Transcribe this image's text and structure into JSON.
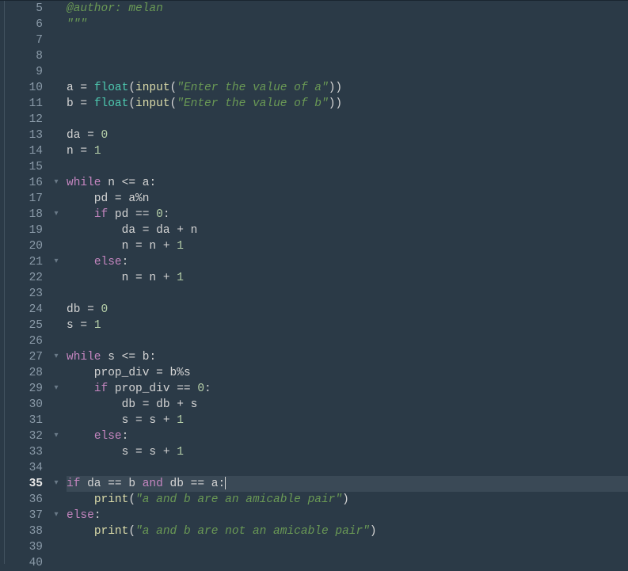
{
  "lines": [
    {
      "num": 5,
      "fold": "",
      "highlight": false,
      "tokens": [
        [
          "cm",
          "@author: melan"
        ]
      ]
    },
    {
      "num": 6,
      "fold": "",
      "highlight": false,
      "tokens": [
        [
          "str",
          "\"\"\""
        ]
      ]
    },
    {
      "num": 7,
      "fold": "",
      "highlight": false,
      "tokens": []
    },
    {
      "num": 8,
      "fold": "",
      "highlight": false,
      "tokens": []
    },
    {
      "num": 9,
      "fold": "",
      "highlight": false,
      "tokens": []
    },
    {
      "num": 10,
      "fold": "",
      "highlight": false,
      "tokens": [
        [
          "id",
          "a "
        ],
        [
          "op",
          "= "
        ],
        [
          "fn",
          "float"
        ],
        [
          "op",
          "("
        ],
        [
          "bi",
          "input"
        ],
        [
          "op",
          "("
        ],
        [
          "str",
          "\"Enter the value of a\""
        ],
        [
          "op",
          "))"
        ]
      ]
    },
    {
      "num": 11,
      "fold": "",
      "highlight": false,
      "tokens": [
        [
          "id",
          "b "
        ],
        [
          "op",
          "= "
        ],
        [
          "fn",
          "float"
        ],
        [
          "op",
          "("
        ],
        [
          "bi",
          "input"
        ],
        [
          "op",
          "("
        ],
        [
          "str",
          "\"Enter the value of b\""
        ],
        [
          "op",
          "))"
        ]
      ]
    },
    {
      "num": 12,
      "fold": "",
      "highlight": false,
      "tokens": []
    },
    {
      "num": 13,
      "fold": "",
      "highlight": false,
      "tokens": [
        [
          "id",
          "da "
        ],
        [
          "op",
          "= "
        ],
        [
          "num",
          "0"
        ]
      ]
    },
    {
      "num": 14,
      "fold": "",
      "highlight": false,
      "tokens": [
        [
          "id",
          "n "
        ],
        [
          "op",
          "= "
        ],
        [
          "num",
          "1"
        ]
      ]
    },
    {
      "num": 15,
      "fold": "",
      "highlight": false,
      "tokens": []
    },
    {
      "num": 16,
      "fold": "▾",
      "highlight": false,
      "tokens": [
        [
          "kw",
          "while"
        ],
        [
          "id",
          " n "
        ],
        [
          "op",
          "<= "
        ],
        [
          "id",
          "a"
        ],
        [
          "op",
          ":"
        ]
      ]
    },
    {
      "num": 17,
      "fold": "",
      "highlight": false,
      "tokens": [
        [
          "id",
          "    pd "
        ],
        [
          "op",
          "= "
        ],
        [
          "id",
          "a"
        ],
        [
          "op",
          "%"
        ],
        [
          "id",
          "n"
        ]
      ]
    },
    {
      "num": 18,
      "fold": "▾",
      "highlight": false,
      "tokens": [
        [
          "id",
          "    "
        ],
        [
          "kw",
          "if"
        ],
        [
          "id",
          " pd "
        ],
        [
          "op",
          "== "
        ],
        [
          "num",
          "0"
        ],
        [
          "op",
          ":"
        ]
      ]
    },
    {
      "num": 19,
      "fold": "",
      "highlight": false,
      "tokens": [
        [
          "id",
          "        da "
        ],
        [
          "op",
          "= "
        ],
        [
          "id",
          "da "
        ],
        [
          "op",
          "+ "
        ],
        [
          "id",
          "n"
        ]
      ]
    },
    {
      "num": 20,
      "fold": "",
      "highlight": false,
      "tokens": [
        [
          "id",
          "        n "
        ],
        [
          "op",
          "= "
        ],
        [
          "id",
          "n "
        ],
        [
          "op",
          "+ "
        ],
        [
          "num",
          "1"
        ]
      ]
    },
    {
      "num": 21,
      "fold": "▾",
      "highlight": false,
      "tokens": [
        [
          "id",
          "    "
        ],
        [
          "kw",
          "else"
        ],
        [
          "op",
          ":"
        ]
      ]
    },
    {
      "num": 22,
      "fold": "",
      "highlight": false,
      "tokens": [
        [
          "id",
          "        n "
        ],
        [
          "op",
          "= "
        ],
        [
          "id",
          "n "
        ],
        [
          "op",
          "+ "
        ],
        [
          "num",
          "1"
        ]
      ]
    },
    {
      "num": 23,
      "fold": "",
      "highlight": false,
      "tokens": []
    },
    {
      "num": 24,
      "fold": "",
      "highlight": false,
      "tokens": [
        [
          "id",
          "db "
        ],
        [
          "op",
          "= "
        ],
        [
          "num",
          "0"
        ]
      ]
    },
    {
      "num": 25,
      "fold": "",
      "highlight": false,
      "tokens": [
        [
          "id",
          "s "
        ],
        [
          "op",
          "= "
        ],
        [
          "num",
          "1"
        ]
      ]
    },
    {
      "num": 26,
      "fold": "",
      "highlight": false,
      "tokens": []
    },
    {
      "num": 27,
      "fold": "▾",
      "highlight": false,
      "tokens": [
        [
          "kw",
          "while"
        ],
        [
          "id",
          " s "
        ],
        [
          "op",
          "<= "
        ],
        [
          "id",
          "b"
        ],
        [
          "op",
          ":"
        ]
      ]
    },
    {
      "num": 28,
      "fold": "",
      "highlight": false,
      "tokens": [
        [
          "id",
          "    prop_div "
        ],
        [
          "op",
          "= "
        ],
        [
          "id",
          "b"
        ],
        [
          "op",
          "%"
        ],
        [
          "id",
          "s"
        ]
      ]
    },
    {
      "num": 29,
      "fold": "▾",
      "highlight": false,
      "tokens": [
        [
          "id",
          "    "
        ],
        [
          "kw",
          "if"
        ],
        [
          "id",
          " prop_div "
        ],
        [
          "op",
          "== "
        ],
        [
          "num",
          "0"
        ],
        [
          "op",
          ":"
        ]
      ]
    },
    {
      "num": 30,
      "fold": "",
      "highlight": false,
      "tokens": [
        [
          "id",
          "        db "
        ],
        [
          "op",
          "= "
        ],
        [
          "id",
          "db "
        ],
        [
          "op",
          "+ "
        ],
        [
          "id",
          "s"
        ]
      ]
    },
    {
      "num": 31,
      "fold": "",
      "highlight": false,
      "tokens": [
        [
          "id",
          "        s "
        ],
        [
          "op",
          "= "
        ],
        [
          "id",
          "s "
        ],
        [
          "op",
          "+ "
        ],
        [
          "num",
          "1"
        ]
      ]
    },
    {
      "num": 32,
      "fold": "▾",
      "highlight": false,
      "tokens": [
        [
          "id",
          "    "
        ],
        [
          "kw",
          "else"
        ],
        [
          "op",
          ":"
        ]
      ]
    },
    {
      "num": 33,
      "fold": "",
      "highlight": false,
      "tokens": [
        [
          "id",
          "        s "
        ],
        [
          "op",
          "= "
        ],
        [
          "id",
          "s "
        ],
        [
          "op",
          "+ "
        ],
        [
          "num",
          "1"
        ]
      ]
    },
    {
      "num": 34,
      "fold": "",
      "highlight": false,
      "tokens": []
    },
    {
      "num": 35,
      "fold": "▾",
      "highlight": true,
      "tokens": [
        [
          "kw",
          "if"
        ],
        [
          "id",
          " da "
        ],
        [
          "op",
          "== "
        ],
        [
          "id",
          "b "
        ],
        [
          "kw",
          "and"
        ],
        [
          "id",
          " db "
        ],
        [
          "op",
          "== "
        ],
        [
          "id",
          "a"
        ],
        [
          "op",
          ":"
        ]
      ],
      "cursor": true
    },
    {
      "num": 36,
      "fold": "",
      "highlight": false,
      "tokens": [
        [
          "id",
          "    "
        ],
        [
          "bi",
          "print"
        ],
        [
          "op",
          "("
        ],
        [
          "str",
          "\"a and b are an amicable pair\""
        ],
        [
          "op",
          ")"
        ]
      ]
    },
    {
      "num": 37,
      "fold": "▾",
      "highlight": false,
      "tokens": [
        [
          "kw",
          "else"
        ],
        [
          "op",
          ":"
        ]
      ]
    },
    {
      "num": 38,
      "fold": "",
      "highlight": false,
      "tokens": [
        [
          "id",
          "    "
        ],
        [
          "bi",
          "print"
        ],
        [
          "op",
          "("
        ],
        [
          "str",
          "\"a and b are not an amicable pair\""
        ],
        [
          "op",
          ")"
        ]
      ]
    },
    {
      "num": 39,
      "fold": "",
      "highlight": false,
      "tokens": []
    },
    {
      "num": 40,
      "fold": "",
      "highlight": false,
      "tokens": []
    }
  ]
}
